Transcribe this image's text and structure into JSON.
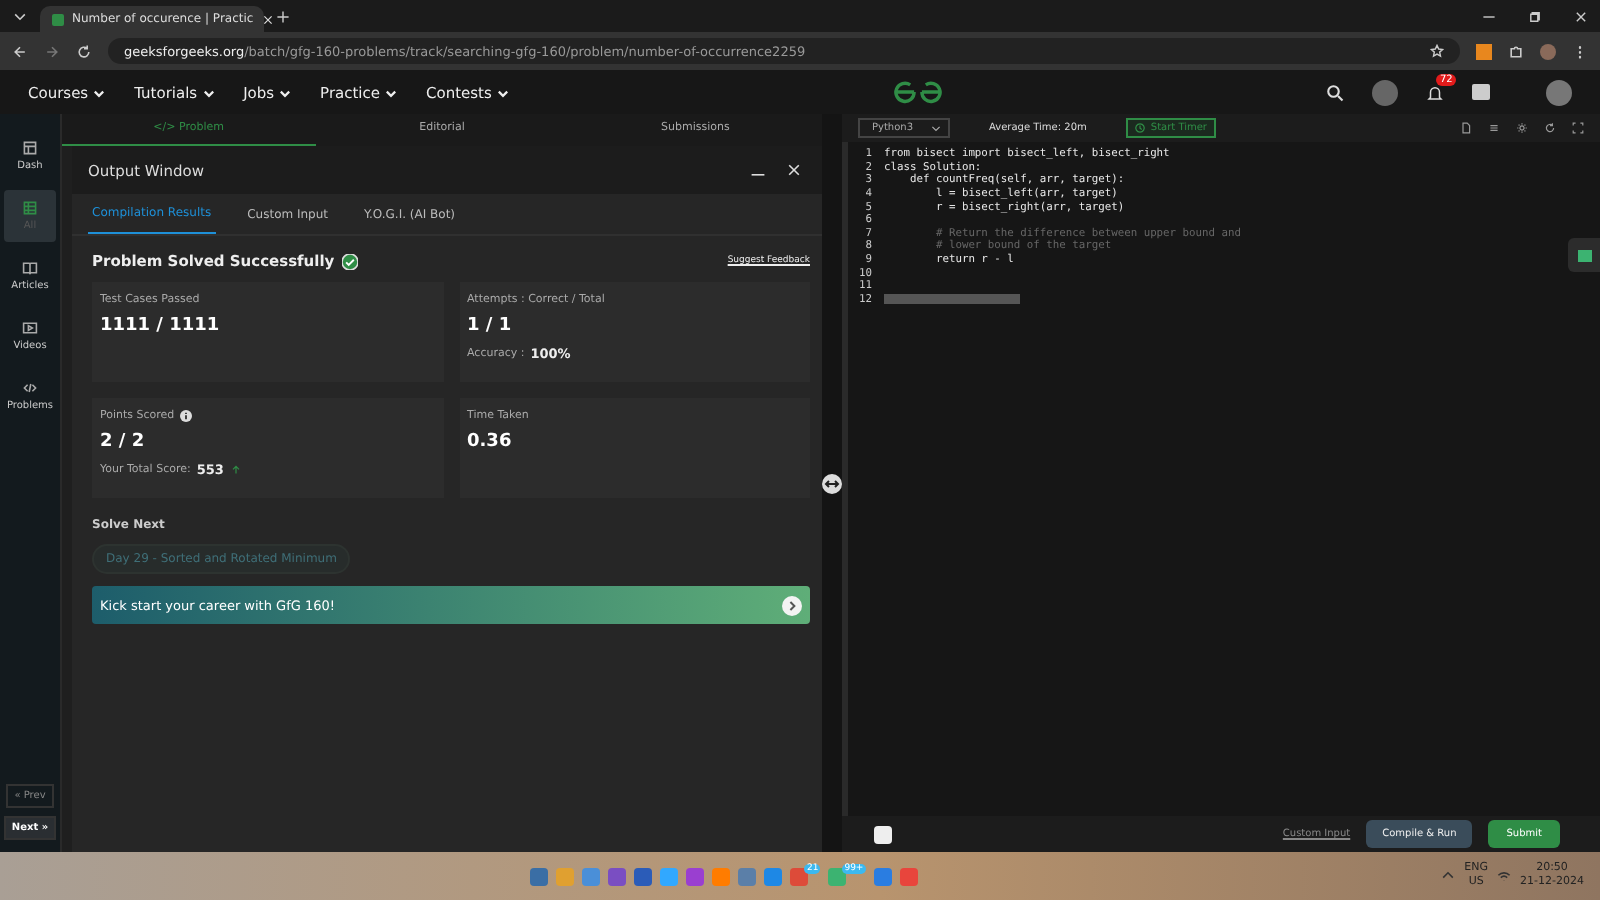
{
  "browser": {
    "tab_title": "Number of occurence | Practic",
    "url_domain": "geeksforgeeks.org",
    "url_path": "/batch/gfg-160-problems/track/searching-gfg-160/problem/number-of-occurrence2259"
  },
  "nav": {
    "menus": [
      "Courses",
      "Tutorials",
      "Jobs",
      "Practice",
      "Contests"
    ],
    "notification_count": "72"
  },
  "sidebar": {
    "items": [
      {
        "label": "Dash",
        "selected": false
      },
      {
        "label": "All",
        "selected": true
      },
      {
        "label": "Articles",
        "selected": false
      },
      {
        "label": "Videos",
        "selected": false
      },
      {
        "label": "Problems",
        "selected": false
      }
    ],
    "prev": "« Prev",
    "next": "Next »"
  },
  "problem_tabs": [
    {
      "label": "</> Problem",
      "selected": true
    },
    {
      "label": "Editorial",
      "selected": false
    },
    {
      "label": "Submissions",
      "selected": false
    }
  ],
  "output": {
    "title": "Output Window",
    "tabs": [
      {
        "label": "Compilation Results",
        "selected": true
      },
      {
        "label": "Custom Input",
        "selected": false
      },
      {
        "label": "Y.O.G.I. (AI Bot)",
        "selected": false
      }
    ],
    "status": "Problem Solved Successfully",
    "feedback": "Suggest Feedback",
    "cards": [
      {
        "label": "Test Cases Passed",
        "value": "1111 / 1111"
      },
      {
        "label": "Attempts : Correct / Total",
        "value": "1 / 1",
        "sub_label": "Accuracy :",
        "sub_value": "100%"
      },
      {
        "label": "Points Scored",
        "value": "2 / 2",
        "sub_label": "Your Total Score:",
        "sub_value": "553",
        "info": true
      },
      {
        "label": "Time Taken",
        "value": "0.36"
      }
    ],
    "solve_next": "Solve Next",
    "next_problem": "Day 29 - Sorted and Rotated Minimum",
    "banner": "Kick start your career with GfG 160!"
  },
  "editor": {
    "language": "Python3",
    "avg_time": "Average Time: 20m",
    "timer": "Start Timer",
    "lines": [
      {
        "n": "1",
        "text": "from bisect import bisect_left, bisect_right",
        "kind": "code"
      },
      {
        "n": "2",
        "text": "class Solution:",
        "kind": "code"
      },
      {
        "n": "3",
        "text": "    def countFreq(self, arr, target):",
        "kind": "code"
      },
      {
        "n": "4",
        "text": "        l = bisect_left(arr, target)",
        "kind": "code"
      },
      {
        "n": "5",
        "text": "        r = bisect_right(arr, target)",
        "kind": "code"
      },
      {
        "n": "6",
        "kind": "code"
      },
      {
        "n": "7",
        "text": "        # Return the difference between upper bound and",
        "kind": "comment"
      },
      {
        "n": "8",
        "text": "        # lower bound of the target",
        "kind": "comment"
      },
      {
        "n": "9",
        "text": "        return r - l",
        "kind": "code"
      },
      {
        "n": "10",
        "kind": "code"
      },
      {
        "n": "11",
        "kind": "code"
      },
      {
        "n": "12",
        "kind": "cursor"
      }
    ],
    "custom_input": "Custom Input",
    "compile": "Compile & Run",
    "submit": "Submit"
  },
  "taskbar": {
    "badges": [
      "21",
      "99+"
    ],
    "lang": "ENG",
    "region": "US",
    "time": "20:50",
    "date": "21-12-2024"
  }
}
